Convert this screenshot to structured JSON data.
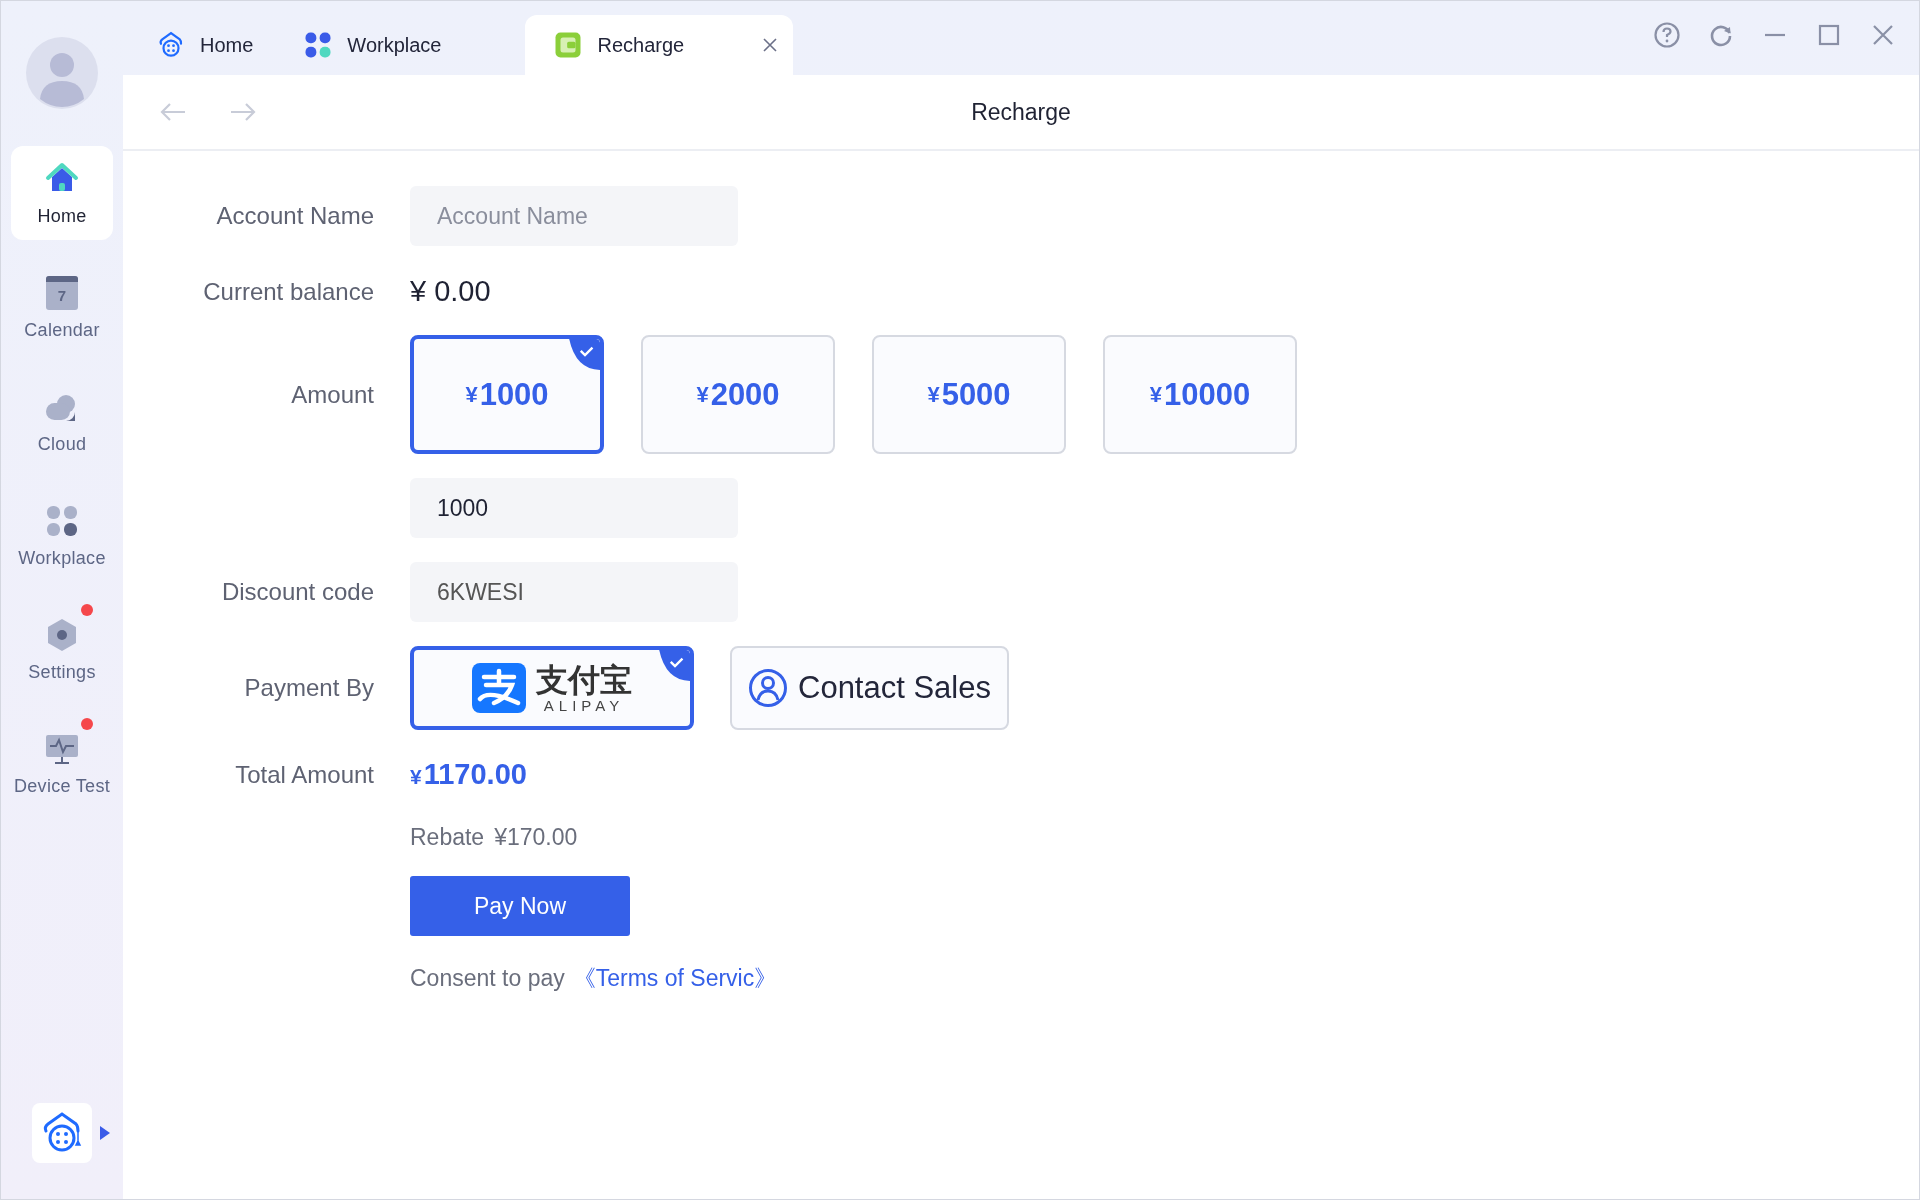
{
  "tabs": [
    {
      "label": "Home",
      "selected": false,
      "closable": false
    },
    {
      "label": "Workplace",
      "selected": false,
      "closable": false
    },
    {
      "label": "Recharge",
      "selected": true,
      "closable": true
    }
  ],
  "sidebar": {
    "items": [
      {
        "label": "Home",
        "selected": true,
        "badge": false
      },
      {
        "label": "Calendar",
        "selected": false,
        "badge": false,
        "icon_text": "7"
      },
      {
        "label": "Cloud",
        "selected": false,
        "badge": false
      },
      {
        "label": "Workplace",
        "selected": false,
        "badge": false
      },
      {
        "label": "Settings",
        "selected": false,
        "badge": true
      },
      {
        "label": "Device Test",
        "selected": false,
        "badge": true
      }
    ]
  },
  "page_title": "Recharge",
  "form": {
    "account_name": {
      "label": "Account Name",
      "placeholder": "Account Name"
    },
    "balance": {
      "label": "Current balance",
      "value": "¥ 0.00"
    },
    "amount": {
      "label": "Amount",
      "options": [
        {
          "currency": "¥",
          "value": "1000",
          "selected": true
        },
        {
          "currency": "¥",
          "value": "2000",
          "selected": false
        },
        {
          "currency": "¥",
          "value": "5000",
          "selected": false
        },
        {
          "currency": "¥",
          "value": "10000",
          "selected": false
        }
      ],
      "custom_value": "1000"
    },
    "discount": {
      "label": "Discount code",
      "value": "6KWESI"
    },
    "payment": {
      "label": "Payment By",
      "options": [
        {
          "kind": "alipay",
          "text": "支付宝",
          "subtext": "ALIPAY",
          "selected": true
        },
        {
          "kind": "contact",
          "text": "Contact Sales",
          "selected": false
        }
      ]
    },
    "total": {
      "label": "Total Amount",
      "currency": "¥",
      "value": "1170.00"
    },
    "rebate": {
      "label": "Rebate",
      "value": "¥170.00"
    },
    "pay_button": "Pay Now",
    "consent": {
      "text": "Consent to pay",
      "link": "《Terms of Servic》"
    }
  }
}
